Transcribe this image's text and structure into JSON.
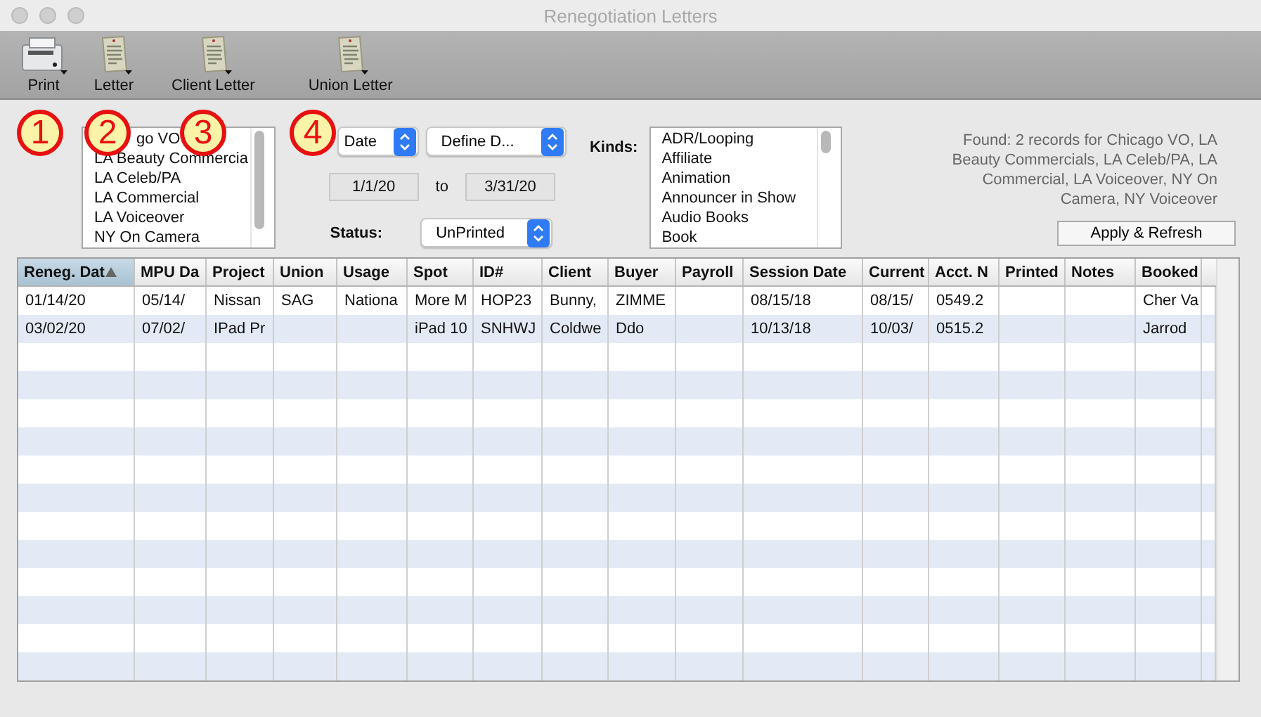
{
  "window": {
    "title": "Renegotiation Letters"
  },
  "toolbar": [
    {
      "label": "Print",
      "kind": "printer"
    },
    {
      "label": "Letter",
      "kind": "letter"
    },
    {
      "label": "Client Letter",
      "kind": "letter"
    },
    {
      "label": "Union Letter",
      "kind": "letter"
    }
  ],
  "callouts": [
    "1",
    "2",
    "3",
    "4"
  ],
  "offices": [
    "go VO",
    "LA Beauty Commercia",
    "LA Celeb/PA",
    "LA Commercial",
    "LA Voiceover",
    "NY On Camera"
  ],
  "date_field": {
    "value": "Date"
  },
  "date_range": {
    "value": "Define D..."
  },
  "from": "1/1/20",
  "to_label": "to",
  "to": "3/31/20",
  "status": {
    "label": "Status:",
    "value": "UnPrinted"
  },
  "kinds": {
    "label": "Kinds:",
    "items": [
      "ADR/Looping",
      "Affiliate",
      "Animation",
      "Announcer in Show",
      "Audio Books",
      "Book"
    ]
  },
  "found": "Found: 2 records for Chicago VO, LA Beauty Commercials, LA Celeb/PA, LA Commercial, LA Voiceover, NY On Camera, NY Voiceover",
  "apply_button": "Apply & Refresh",
  "table": {
    "columns": [
      {
        "label": "Reneg. Dat",
        "sorted": true
      },
      {
        "label": "MPU Da",
        "sorted": false
      },
      {
        "label": "Project",
        "sorted": false
      },
      {
        "label": "Union",
        "sorted": false
      },
      {
        "label": "Usage",
        "sorted": false
      },
      {
        "label": "Spot",
        "sorted": false
      },
      {
        "label": "ID#",
        "sorted": false
      },
      {
        "label": "Client",
        "sorted": false
      },
      {
        "label": "Buyer",
        "sorted": false
      },
      {
        "label": "Payroll",
        "sorted": false
      },
      {
        "label": "Session Date",
        "sorted": false
      },
      {
        "label": "Current",
        "sorted": false
      },
      {
        "label": "Acct. N",
        "sorted": false
      },
      {
        "label": "Printed",
        "sorted": false
      },
      {
        "label": "Notes",
        "sorted": false
      },
      {
        "label": "Booked",
        "sorted": false
      }
    ],
    "rows": [
      [
        "01/14/20",
        "05/14/",
        "Nissan",
        "SAG",
        "Nationa",
        "More M",
        "HOP23",
        "Bunny,",
        "ZIMME",
        "",
        "08/15/18",
        "08/15/",
        "0549.2",
        "",
        "",
        "Cher Va"
      ],
      [
        "03/02/20",
        "07/02/",
        "IPad Pr",
        "",
        "",
        "iPad 10",
        "SNHWJ",
        "Coldwe",
        "Ddo",
        "",
        "10/13/18",
        "10/03/",
        "0515.2",
        "",
        "",
        "Jarrod"
      ]
    ]
  }
}
